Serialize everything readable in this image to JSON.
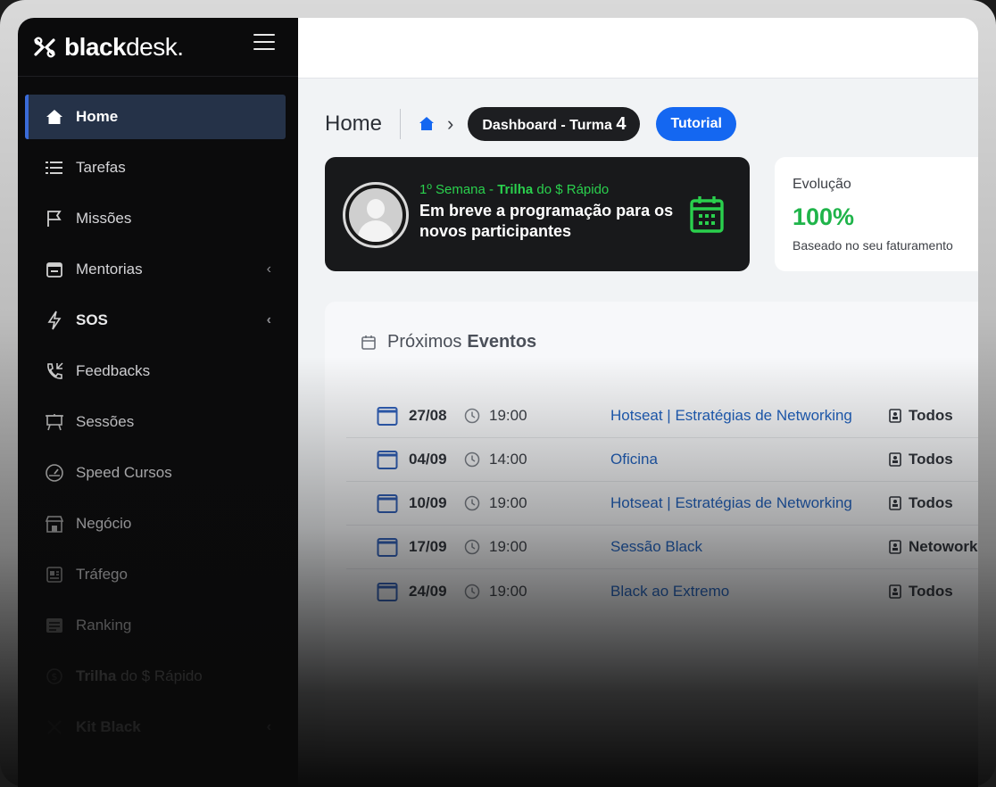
{
  "brand": {
    "bold": "black",
    "light": "desk."
  },
  "nav": {
    "items": [
      {
        "label": "Home"
      },
      {
        "label": "Tarefas"
      },
      {
        "label": "Missões"
      },
      {
        "label": "Mentorias"
      },
      {
        "label": "SOS"
      },
      {
        "label": "Feedbacks"
      },
      {
        "label": "Sessões"
      },
      {
        "label": "Speed Cursos"
      },
      {
        "label": "Negócio"
      },
      {
        "label": "Tráfego"
      },
      {
        "label": "Ranking"
      },
      {
        "label_bold": "Trilha",
        "label_rest": " do  $  Rápido"
      },
      {
        "label": "Kit Black"
      }
    ]
  },
  "breadcrumb": {
    "title": "Home",
    "dashboard_label": "Dashboard - Turma ",
    "dashboard_number": "4",
    "tutorial_label": "Tutorial"
  },
  "banner": {
    "week": "1º Semana - ",
    "trilha": "Trilha",
    "rest": " do  $  Rápido",
    "message": "Em breve a programação para os novos participantes"
  },
  "evolution": {
    "label": "Evolução",
    "value": "100%",
    "subtitle": "Baseado no seu faturamento"
  },
  "events": {
    "heading_light": "Próximos",
    "heading_bold": "Eventos",
    "rows": [
      {
        "date": "27/08",
        "time": "19:00",
        "title": "Hotseat | Estratégias de Networking",
        "audience": "Todos"
      },
      {
        "date": "04/09",
        "time": "14:00",
        "title": "Oficina",
        "audience": "Todos"
      },
      {
        "date": "10/09",
        "time": "19:00",
        "title": "Hotseat | Estratégias de Networking",
        "audience": "Todos"
      },
      {
        "date": "17/09",
        "time": "19:00",
        "title": "Sessão Black",
        "audience": "Netoworking"
      },
      {
        "date": "24/09",
        "time": "19:00",
        "title": "Black ao Extremo",
        "audience": "Todos"
      }
    ]
  },
  "colors": {
    "accent_blue": "#1467f1",
    "success_green": "#1fb44a",
    "sidebar_bg": "#0b0b0c",
    "active_item_bg": "#253248"
  }
}
